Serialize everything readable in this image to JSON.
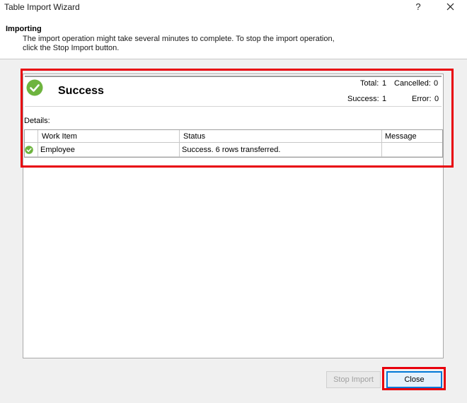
{
  "window": {
    "title": "Table Import Wizard",
    "help_label": "?"
  },
  "header": {
    "step_title": "Importing",
    "step_description": "The import operation might take several minutes to complete. To stop the import operation, click the Stop Import button."
  },
  "summary": {
    "status_label": "Success",
    "total_label": "Total:",
    "total_value": "1",
    "cancelled_label": "Cancelled:",
    "cancelled_value": "0",
    "success_label": "Success:",
    "success_value": "1",
    "error_label": "Error:",
    "error_value": "0",
    "status_icon": "check-circle-icon",
    "status_color": "#6eb43f"
  },
  "details": {
    "label": "Details:",
    "columns": [
      "Work Item",
      "Status",
      "Message"
    ],
    "rows": [
      {
        "icon": "check-circle-icon",
        "work_item": "Employee",
        "status": "Success. 6 rows transferred.",
        "message": ""
      }
    ]
  },
  "buttons": {
    "stop_import": "Stop Import",
    "close": "Close"
  },
  "colors": {
    "highlight": "#e8000b",
    "success_green": "#6eb43f",
    "focus_blue": "#0078d7"
  }
}
